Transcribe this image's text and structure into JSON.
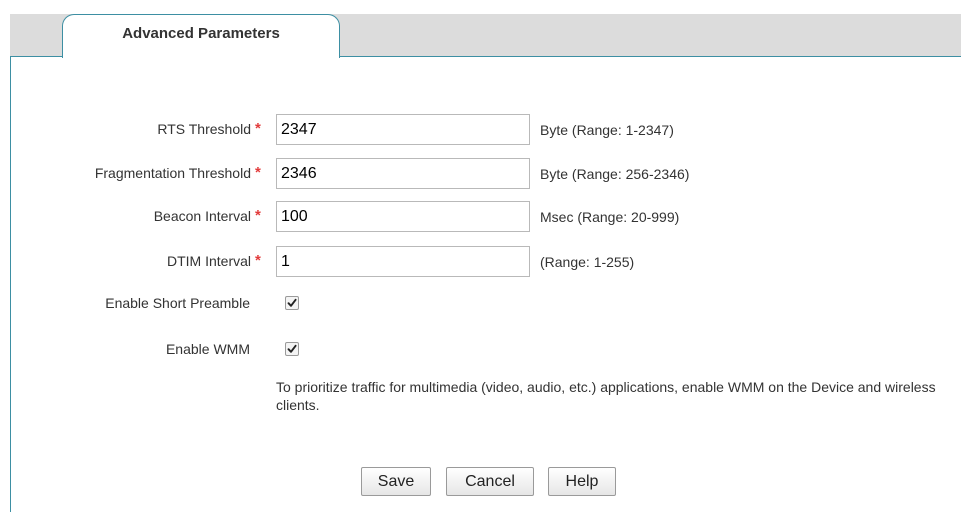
{
  "tab": {
    "label": "Advanced Parameters"
  },
  "fields": [
    {
      "label": "RTS Threshold",
      "value": "2347",
      "hint": "Byte (Range: 1-2347)",
      "required": "*"
    },
    {
      "label": "Fragmentation Threshold",
      "value": "2346",
      "hint": "Byte (Range: 256-2346)",
      "required": "*"
    },
    {
      "label": "Beacon Interval",
      "value": "100",
      "hint": "Msec (Range: 20-999)",
      "required": "*"
    },
    {
      "label": "DTIM Interval",
      "value": "1",
      "hint": "(Range: 1-255)",
      "required": "*"
    }
  ],
  "checkboxes": [
    {
      "label": "Enable Short Preamble",
      "checked": true
    },
    {
      "label": "Enable WMM",
      "checked": true
    }
  ],
  "wmm_note": "To prioritize traffic for multimedia (video, audio, etc.) applications, enable WMM on the Device and wireless clients.",
  "buttons": {
    "save": "Save",
    "cancel": "Cancel",
    "help": "Help"
  },
  "colors": {
    "required": "#e23b3b",
    "tab_border": "#3d8fa3",
    "tab_bar": "#dcdcdc"
  }
}
